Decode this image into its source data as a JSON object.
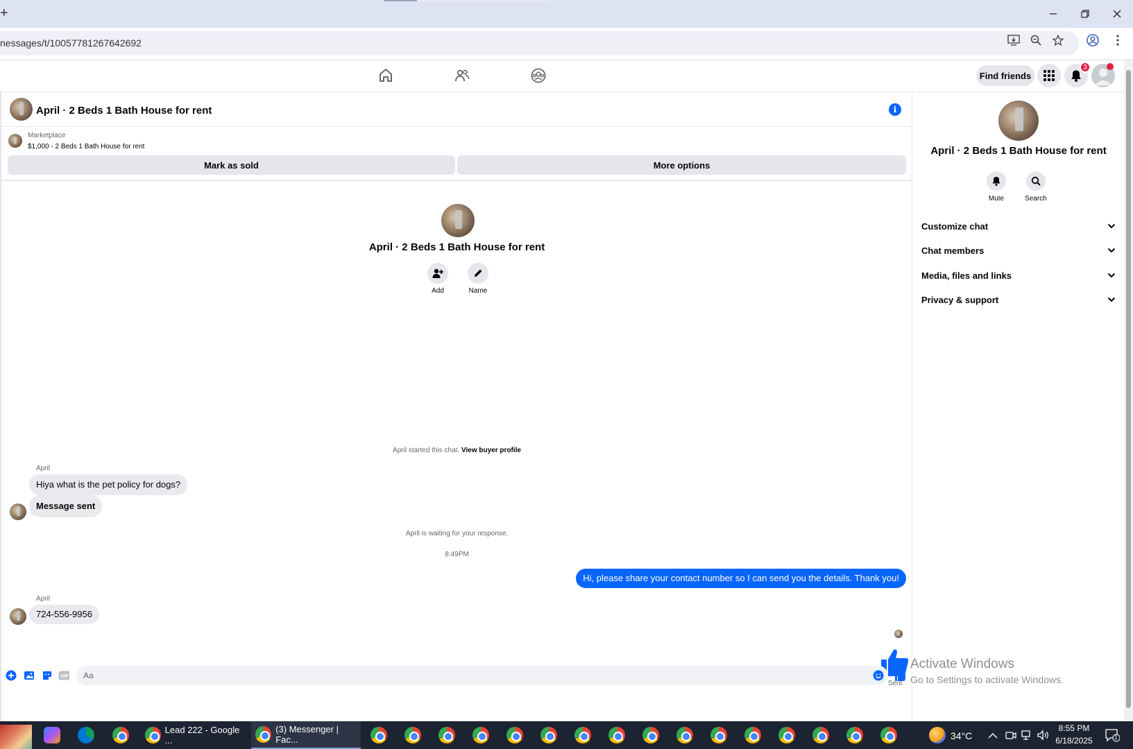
{
  "browser": {
    "url": "nessages/t/10057781267642692",
    "new_tab_glyph": "+"
  },
  "fb_header": {
    "find_friends": "Find friends",
    "notification_count": "3"
  },
  "chat": {
    "title": "April · 2 Beds 1 Bath House for rent",
    "marketplace_label": "Marketplace",
    "listing": "$1,000 - 2 Beds 1 Bath House for rent",
    "mark_sold": "Mark as sold",
    "more_options": "More options",
    "intro_name": "April · 2 Beds 1 Bath House for rent",
    "add_label": "Add",
    "name_label": "Name",
    "started_text": "April started this chat.",
    "view_buyer": "View buyer profile",
    "messages": [
      {
        "sender": "April",
        "text": "Hiya what is the pet policy for dogs?"
      },
      {
        "text": "Message sent"
      }
    ],
    "waiting_text": "April is waiting for your response.",
    "time": "8:49PM",
    "outgoing": "Hi, please share your contact number so I can send you the details. Thank you!",
    "reply_sender": "April",
    "reply_text": "724-556-9956",
    "sent_label": "Sent",
    "composer_placeholder": "Aa"
  },
  "panel": {
    "title": "April · 2 Beds 1 Bath House for rent",
    "mute": "Mute",
    "search": "Search",
    "rows": [
      "Customize chat",
      "Chat members",
      "Media, files and links",
      "Privacy & support"
    ]
  },
  "watermark": {
    "line1": "Activate Windows",
    "line2": "Go to Settings to activate Windows."
  },
  "taskbar": {
    "task1": "Lead 222 - Google ...",
    "task2": "(3) Messenger | Fac...",
    "temp": "34°C",
    "time": "8:55 PM",
    "date": "6/18/2025",
    "action_count": "1"
  }
}
